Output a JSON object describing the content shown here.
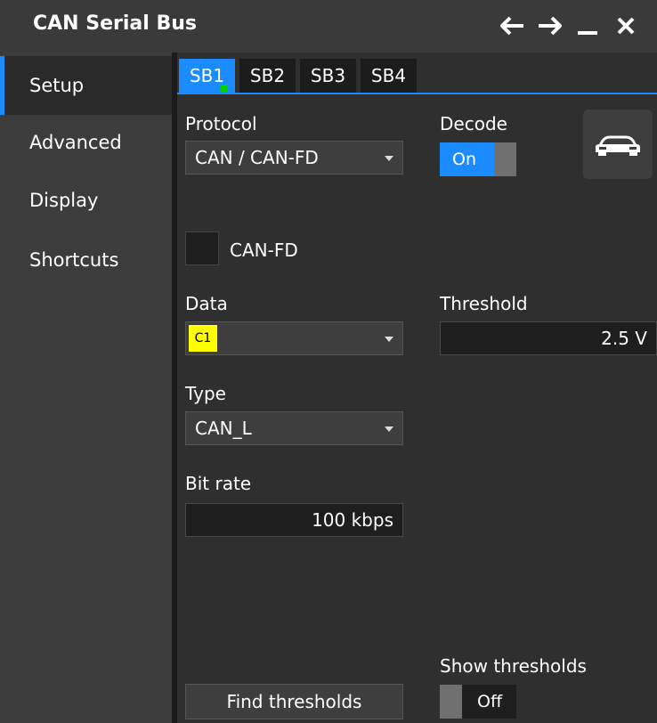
{
  "window": {
    "title": "CAN Serial Bus",
    "controls": [
      "back-arrow-icon",
      "forward-arrow-icon",
      "minimize-icon",
      "close-icon"
    ]
  },
  "sidebar": {
    "items": [
      {
        "label": "Setup",
        "active": true
      },
      {
        "label": "Advanced",
        "active": false
      },
      {
        "label": "Display",
        "active": false
      },
      {
        "label": "Shortcuts",
        "active": false
      }
    ]
  },
  "tabs": [
    {
      "label": "SB1",
      "active": true
    },
    {
      "label": "SB2",
      "active": false
    },
    {
      "label": "SB3",
      "active": false
    },
    {
      "label": "SB4",
      "active": false
    }
  ],
  "setup": {
    "protocol_label": "Protocol",
    "protocol_value": "CAN / CAN-FD",
    "decode_label": "Decode",
    "decode_value": "On",
    "canfd_label": "CAN-FD",
    "data_label": "Data",
    "data_source": "C1",
    "threshold_label": "Threshold",
    "threshold_value": "2.5 V",
    "type_label": "Type",
    "type_value": "CAN_L",
    "bitrate_label": "Bit rate",
    "bitrate_value": "100 kbps",
    "show_thresholds_label": "Show thresholds",
    "show_thresholds_value": "Off",
    "find_thresholds_label": "Find thresholds"
  },
  "colors": {
    "accent": "#1a8cff",
    "channel_c1": "#ffff00",
    "active_indicator": "#00d000"
  }
}
